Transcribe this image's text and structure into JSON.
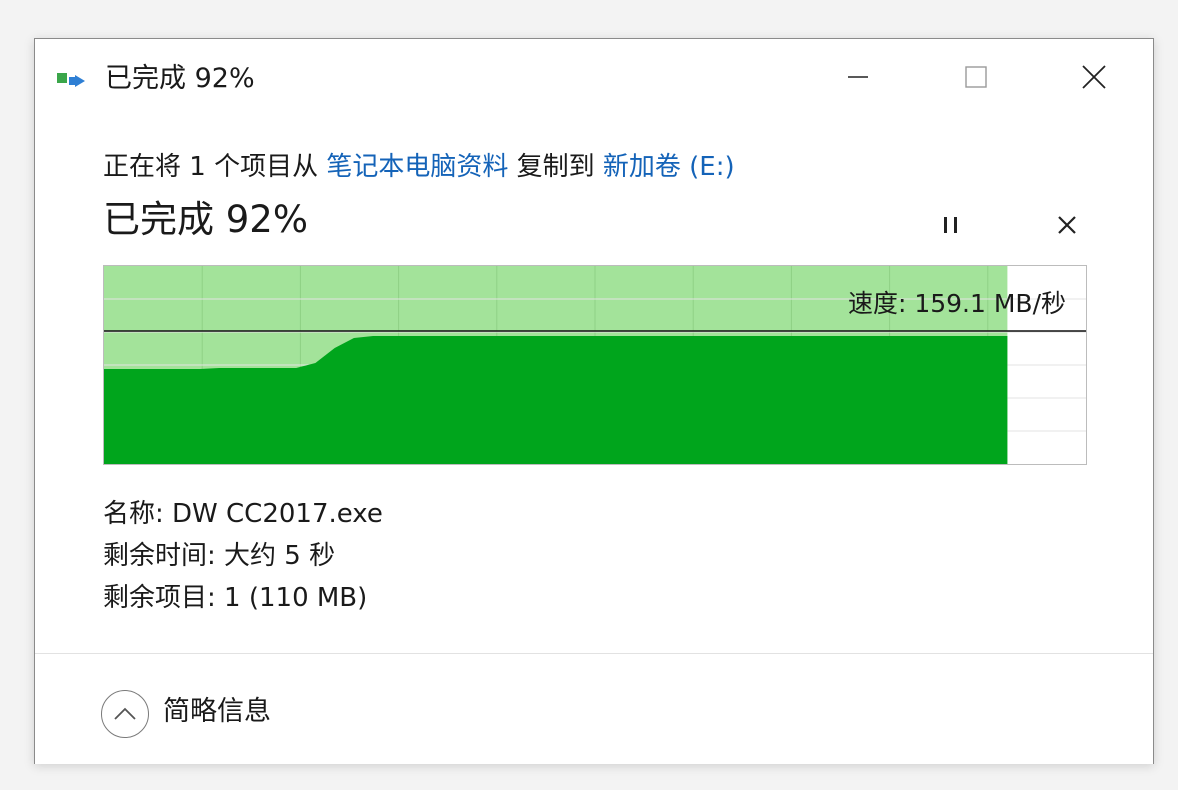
{
  "window": {
    "title": "已完成 92%",
    "icon": "file-copy-icon"
  },
  "controls": {
    "minimize_icon": "minimize-icon",
    "maximize_icon": "maximize-icon",
    "close_icon": "close-icon"
  },
  "status": {
    "prefix": "正在将 1 个项目从 ",
    "source": "笔记本电脑资料",
    "middle": " 复制到 ",
    "destination": "新加卷 (E:)",
    "progress_text": "已完成 92%",
    "progress_fraction": 0.92
  },
  "actions": {
    "pause_icon": "pause-icon",
    "cancel_icon": "cancel-icon"
  },
  "chart_data": {
    "type": "area",
    "speed_label": "速度: 159.1 MB/秒",
    "current_speed_mb_s": 159.1,
    "progress_fraction": 0.92,
    "fill_color": "#00a51c",
    "completed_bg_color": "#a3e39a",
    "series": [
      {
        "values": [
          95,
          95,
          95,
          95,
          95,
          95,
          96,
          96,
          96,
          96,
          96,
          101,
          116,
          126,
          128,
          128,
          128,
          128,
          128,
          128,
          128,
          128,
          128,
          128,
          128,
          128,
          128,
          128,
          128,
          128,
          128,
          128,
          128,
          128,
          128,
          128,
          128,
          128,
          128,
          128,
          128,
          128,
          128,
          128,
          128,
          128,
          128,
          128
        ]
      }
    ]
  },
  "details": {
    "name_label": "名称: ",
    "name_value": "DW CC2017.exe",
    "time_label": "剩余时间: ",
    "time_value": "大约 5 秒",
    "items_label": "剩余项目: ",
    "items_value": "1 (110 MB)"
  },
  "footer": {
    "collapse_label": "简略信息",
    "collapse_icon": "chevron-up-icon"
  }
}
